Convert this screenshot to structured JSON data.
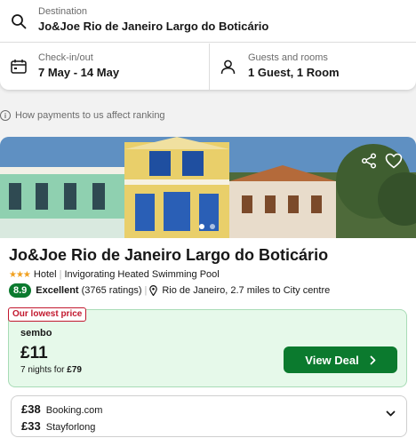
{
  "search": {
    "destination_label": "Destination",
    "destination_value": "Jo&Joe Rio de Janeiro Largo do Boticário",
    "dates_label": "Check-in/out",
    "dates_value": "7 May - 14 May",
    "guests_label": "Guests and rooms",
    "guests_value": "1 Guest, 1 Room",
    "icons": [
      "search-icon",
      "calendar-icon",
      "person-icon"
    ]
  },
  "ranking_info": "How payments to us affect ranking",
  "result": {
    "hotel_name": "Jo&Joe Rio de Janeiro Largo do Boticário",
    "stars": 3,
    "type": "Hotel",
    "amenity": "Invigorating Heated Swimming Pool",
    "score": "8.9",
    "rating_word": "Excellent",
    "rating_count": "(3765 ratings)",
    "location": "Rio de Janeiro, 2.7 miles to City centre",
    "photo_dots": 2,
    "active_dot": 0,
    "best_deal": {
      "badge": "Our lowest price",
      "provider": "sembo",
      "price": "£11",
      "nights_prefix": "7 nights for",
      "nights_total": "£79",
      "button": "View Deal"
    },
    "other_deals": [
      {
        "price": "£38",
        "provider": "Booking.com"
      },
      {
        "price": "£33",
        "provider": "Stayforlong"
      }
    ]
  },
  "colors": {
    "accent_green": "#0b7a2e",
    "deal_background": "#e6f9ea",
    "badge_red": "#c2182e",
    "star": "#f0a020"
  }
}
